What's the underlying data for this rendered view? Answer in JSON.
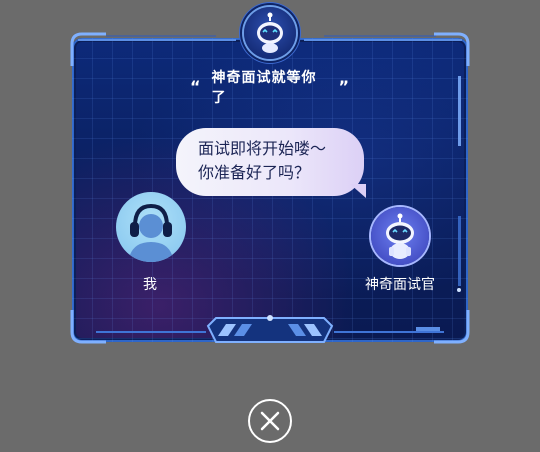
{
  "dialog": {
    "title": "神奇面试就等你了",
    "quote_open": "“",
    "quote_close": "”",
    "bubble": {
      "line1": "面试即将开始喽～",
      "line2": "你准备好了吗？"
    },
    "participants": {
      "me_label": "我",
      "interviewer_label": "神奇面试官"
    }
  },
  "icons": {
    "badge": "robot-icon",
    "me": "user-headphones-icon",
    "interviewer": "robot-icon",
    "close": "close-icon"
  },
  "colors": {
    "overlay": "#6b6b6b",
    "panel": "#0d2a7a",
    "frame_accent": "#5b8fe6",
    "me_avatar": "#8ccaf0",
    "bot_avatar": "#5a68e0"
  }
}
